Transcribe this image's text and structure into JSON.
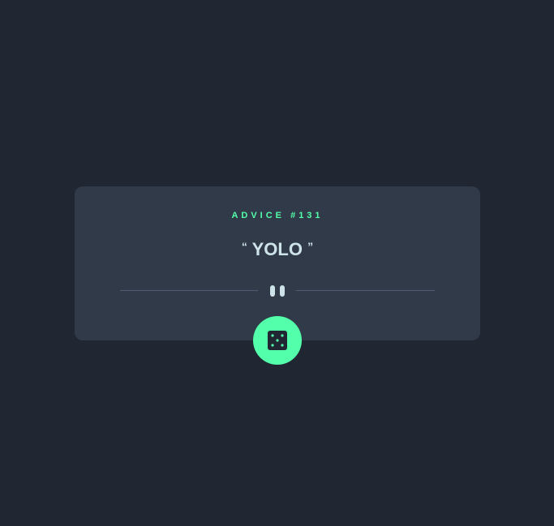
{
  "advice": {
    "id_label": "ADVICE #131",
    "quote_open": "“",
    "text": "YOLO",
    "quote_close": "”"
  },
  "icons": {
    "divider": "pause-icon",
    "button": "dice-icon"
  },
  "colors": {
    "page_background": "#202632",
    "card_background": "#313a48",
    "accent": "#53ffaa",
    "text": "#cee3e9",
    "divider": "#4f5d74"
  }
}
